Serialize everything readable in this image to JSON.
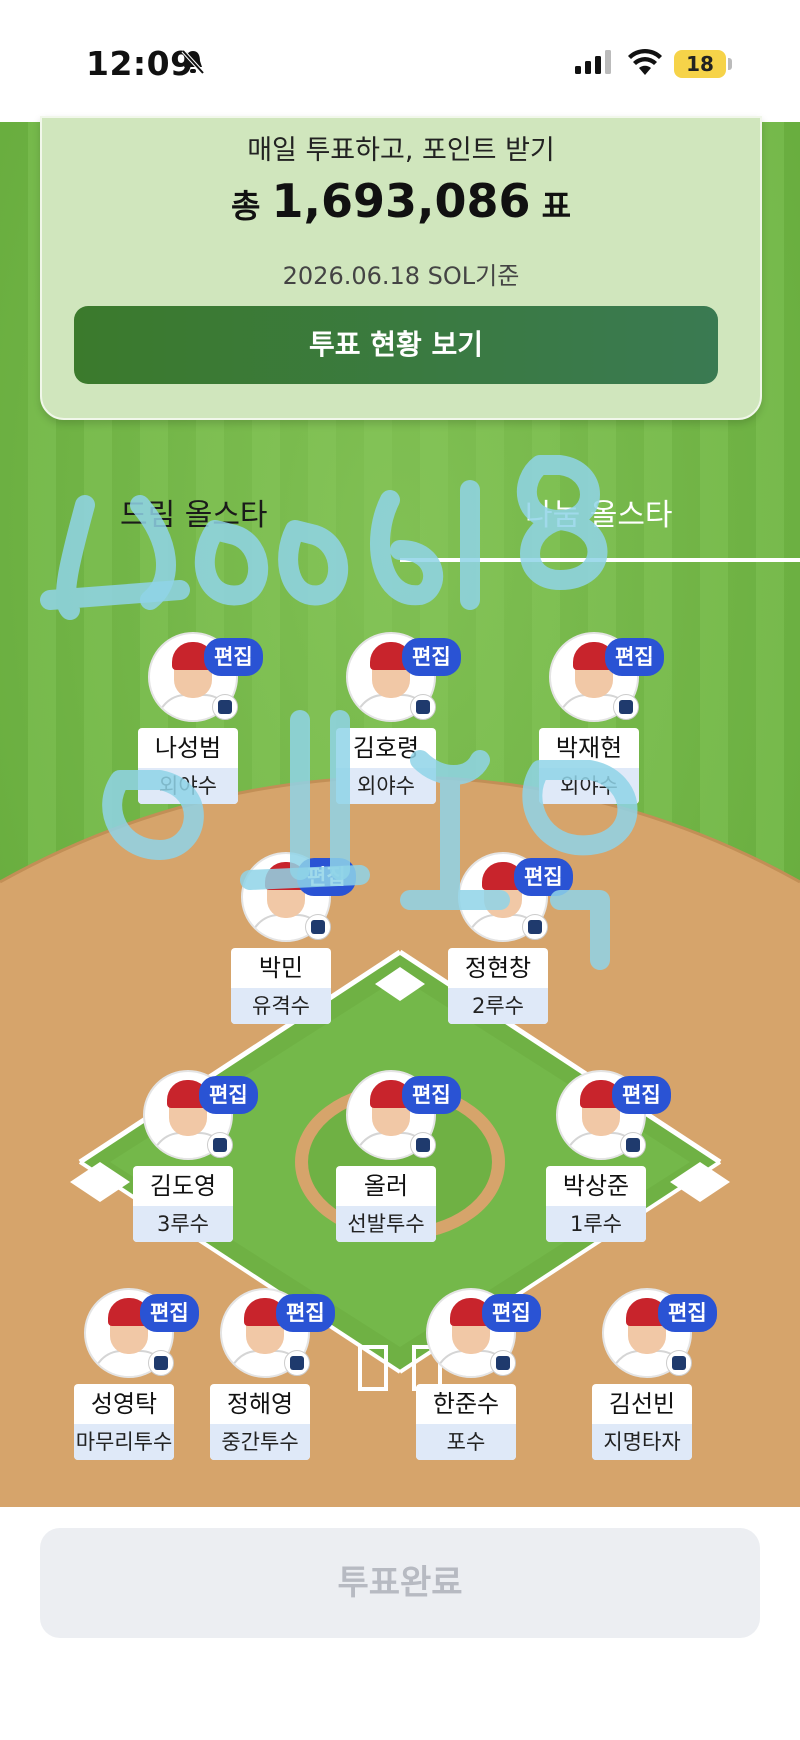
{
  "status_bar": {
    "time": "12:09",
    "battery": "18"
  },
  "vote_card": {
    "headline": "매일 투표하고, 포인트 받기",
    "total_prefix": "총",
    "total_votes": "1,693,086",
    "total_suffix": "표",
    "as_of": "2026.06.18 SOL기준",
    "button_label": "투표 현황 보기"
  },
  "tabs": [
    {
      "label": "드림 올스타",
      "selected": false
    },
    {
      "label": "나눔 올스타",
      "selected": true
    }
  ],
  "edit_label": "편집",
  "players": [
    {
      "name": "나성범",
      "position": "외야수"
    },
    {
      "name": "김호령",
      "position": "외야수"
    },
    {
      "name": "박재현",
      "position": "외야수"
    },
    {
      "name": "박민",
      "position": "유격수"
    },
    {
      "name": "정현창",
      "position": "2루수"
    },
    {
      "name": "김도영",
      "position": "3루수"
    },
    {
      "name": "올러",
      "position": "선발투수"
    },
    {
      "name": "박상준",
      "position": "1루수"
    },
    {
      "name": "성영탁",
      "position": "마무리투수"
    },
    {
      "name": "정해영",
      "position": "중간투수"
    },
    {
      "name": "한준수",
      "position": "포수"
    },
    {
      "name": "김선빈",
      "position": "지명타자"
    }
  ],
  "submit_button": {
    "label": "투표완료"
  },
  "overlay_scribble": "20260618 오유미",
  "colors": {
    "edit_badge": "#2a53d4",
    "field_green": "#6fb144",
    "infield_dirt": "#d7a66d",
    "vote_button": "#3b7a2c"
  }
}
